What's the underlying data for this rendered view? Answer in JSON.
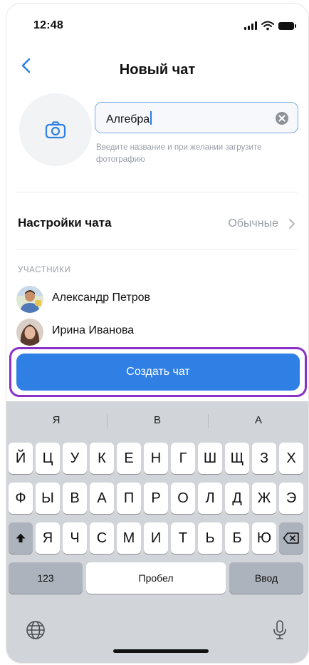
{
  "status_bar": {
    "time": "12:48"
  },
  "nav": {
    "title": "Новый чат"
  },
  "chat_name": {
    "value": "Алгебра",
    "hint": "Введите название и при желании загрузите фотографию"
  },
  "settings": {
    "label": "Настройки чата",
    "value": "Обычные"
  },
  "members": {
    "section_title": "УЧАСТНИКИ",
    "items": [
      {
        "name": "Александр Петров"
      },
      {
        "name": "Ирина Иванова"
      }
    ]
  },
  "create_button": {
    "label": "Создать чат"
  },
  "keyboard": {
    "suggestions": [
      "Я",
      "В",
      "А"
    ],
    "row1": [
      "Й",
      "Ц",
      "У",
      "К",
      "Е",
      "Н",
      "Г",
      "Ш",
      "Щ",
      "З",
      "Х"
    ],
    "row2": [
      "Ф",
      "Ы",
      "В",
      "А",
      "П",
      "Р",
      "О",
      "Л",
      "Д",
      "Ж",
      "Э"
    ],
    "row3": [
      "Я",
      "Ч",
      "С",
      "М",
      "И",
      "Т",
      "Ь",
      "Б",
      "Ю"
    ],
    "numbers_key": "123",
    "space_key": "Пробел",
    "enter_key": "Ввод"
  },
  "colors": {
    "accent": "#2f7fe4",
    "highlight_outline": "#8a2fc7",
    "keyboard_bg": "#d1d4d9"
  },
  "icons": [
    "camera-icon",
    "back-chevron-icon",
    "clear-icon",
    "chevron-right-icon",
    "shift-icon",
    "backspace-icon",
    "globe-icon",
    "mic-icon"
  ]
}
